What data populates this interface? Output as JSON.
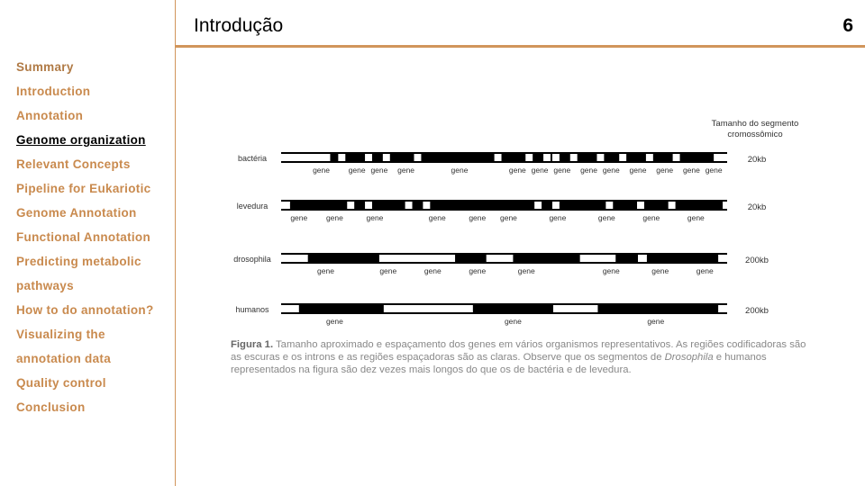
{
  "header": {
    "title": "Introdução",
    "page_number": "6"
  },
  "sidebar": {
    "items": [
      {
        "label": "Summary",
        "active": false
      },
      {
        "label": "Introduction",
        "active": false
      },
      {
        "label": "Annotation",
        "active": false
      },
      {
        "label": "Genome organization",
        "active": true
      },
      {
        "label": "Relevant Concepts",
        "active": false
      },
      {
        "label": "Pipeline for Eukariotic",
        "active": false
      },
      {
        "label": "Genome Annotation",
        "active": false
      },
      {
        "label": "Functional Annotation",
        "active": false
      },
      {
        "label": "Predicting metabolic",
        "active": false
      },
      {
        "label": "pathways",
        "active": false
      },
      {
        "label": "How to do annotation?",
        "active": false
      },
      {
        "label": "Visualizing the",
        "active": false
      },
      {
        "label": "annotation data",
        "active": false
      },
      {
        "label": "Quality control",
        "active": false
      },
      {
        "label": "Conclusion",
        "active": false
      }
    ]
  },
  "figure": {
    "size_header_line1": "Tamanho do segmento",
    "size_header_line2": "cromossômico",
    "gene_label": "gene",
    "rows": [
      {
        "organism": "bactéria",
        "size": "20kb",
        "gene_count": 14
      },
      {
        "organism": "levedura",
        "size": "20kb",
        "gene_count": 10
      },
      {
        "organism": "drosophila",
        "size": "200kb",
        "gene_count": 8
      },
      {
        "organism": "humanos",
        "size": "200kb",
        "gene_count": 3
      }
    ],
    "caption": {
      "label": "Figura 1.",
      "text_part1": " Tamanho aproximado e espaçamento dos genes em vários organismos representativos. As regiões codificadoras são as escuras e os introns e as regiões espaçadoras são as claras. Observe que os segmentos de ",
      "italic": "Drosophila",
      "text_part2": " e humanos representados na figura são dez vezes mais longos do que os de bactéria e de levedura."
    }
  },
  "colors": {
    "accent": "#d1955b",
    "nav_text": "#c98a4e",
    "active_text": "#000000"
  }
}
